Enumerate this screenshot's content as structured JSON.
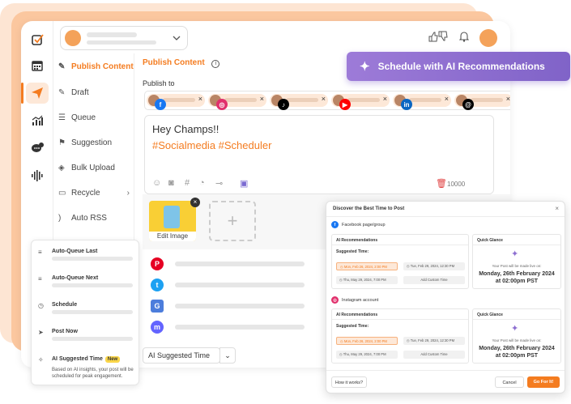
{
  "nav": {
    "items": [
      {
        "icon": "pencil-icon",
        "label": "Publish Content",
        "active": true
      },
      {
        "icon": "draft-icon",
        "label": "Draft"
      },
      {
        "icon": "queue-icon",
        "label": "Queue"
      },
      {
        "icon": "bookmark-icon",
        "label": "Suggestion"
      },
      {
        "icon": "layers-icon",
        "label": "Bulk Upload"
      },
      {
        "icon": "recycle-icon",
        "label": "Recycle"
      },
      {
        "icon": "rss-icon",
        "label": "Auto RSS"
      }
    ]
  },
  "content": {
    "header": "Publish Content",
    "info_icon": "i",
    "publish_to": "Publish to",
    "accounts": [
      {
        "network": "facebook",
        "glyph": "f",
        "color": "#1877f2"
      },
      {
        "network": "instagram",
        "glyph": "◎",
        "color": "#e1306c"
      },
      {
        "network": "tiktok",
        "glyph": "♪",
        "color": "#000000"
      },
      {
        "network": "youtube",
        "glyph": "▶",
        "color": "#ff0000"
      },
      {
        "network": "linkedin",
        "glyph": "in",
        "color": "#0a66c2"
      },
      {
        "network": "threads",
        "glyph": "@",
        "color": "#000000"
      }
    ],
    "remove_glyph": "×",
    "post_greeting": "Hey Champs!!",
    "post_tags": "#Socialmedia #Scheduler",
    "char_count": "10000",
    "edit_image_label": "Edit Image",
    "add_media_glyph": "+",
    "networks": [
      {
        "name": "pinterest",
        "glyph": "P",
        "color": "#e60023"
      },
      {
        "name": "twitter",
        "glyph": "t",
        "color": "#1da1f2"
      },
      {
        "name": "google-business",
        "glyph": "G",
        "color": "#4c7ddc"
      },
      {
        "name": "mastodon",
        "glyph": "m",
        "color": "#6364ff"
      }
    ],
    "ai_time_select": "AI Suggested Time",
    "chevron_glyph": "⌄"
  },
  "schedule_button": {
    "label": "Schedule with AI Recommendations"
  },
  "queue_menu": {
    "items": [
      {
        "label": "Auto-Queue Last",
        "glyph": "≡"
      },
      {
        "label": "Auto-Queue Next",
        "glyph": "≡"
      },
      {
        "label": "Schedule",
        "glyph": "◷"
      },
      {
        "label": "Post Now",
        "glyph": "➤"
      }
    ],
    "ai_item": {
      "label": "AI Suggested Time",
      "badge": "New",
      "glyph": "✧",
      "description": "Based on AI insights, your post will be scheduled for peak engagement."
    }
  },
  "modal": {
    "title": "Discover the Best Time to Post",
    "close_glyph": "×",
    "sections": [
      {
        "account": "Facebook page/group",
        "account_glyph": "f",
        "account_color": "#1877f2",
        "recommend_title": "AI Recommendations",
        "suggested_label": "Suggested Time:",
        "slots": [
          "Mon, Feb 26, 2024, 2:00 PM",
          "Tue, Feb 29, 2024, 12:30 PM",
          "Thu, May 29, 2024, 7:00 PM"
        ],
        "custom_label": "Add Custom Time",
        "glance_title": "Quick Glance",
        "glance_note": "Your Post will be made live on:",
        "glance_date": "Monday, 26th February 2024",
        "glance_time": "at 02:00pm PST"
      },
      {
        "account": "Instagram account",
        "account_glyph": "◎",
        "account_color": "#e1306c",
        "recommend_title": "AI Recommendations",
        "suggested_label": "Suggested Time:",
        "slots": [
          "Mon, Feb 26, 2024, 2:00 PM",
          "Tue, Feb 29, 2024, 12:30 PM",
          "Thu, May 29, 2024, 7:00 PM"
        ],
        "custom_label": "Add Custom Time",
        "glance_title": "Quick Glance",
        "glance_note": "Your Post will be made live on:",
        "glance_date": "Monday, 26th February 2024",
        "glance_time": "at 02:00pm PST"
      }
    ],
    "how_label": "How it works?",
    "cancel_label": "Cancel",
    "go_label": "Go For It!"
  },
  "colors": {
    "accent": "#f47c20",
    "purple": "#8063c8"
  }
}
